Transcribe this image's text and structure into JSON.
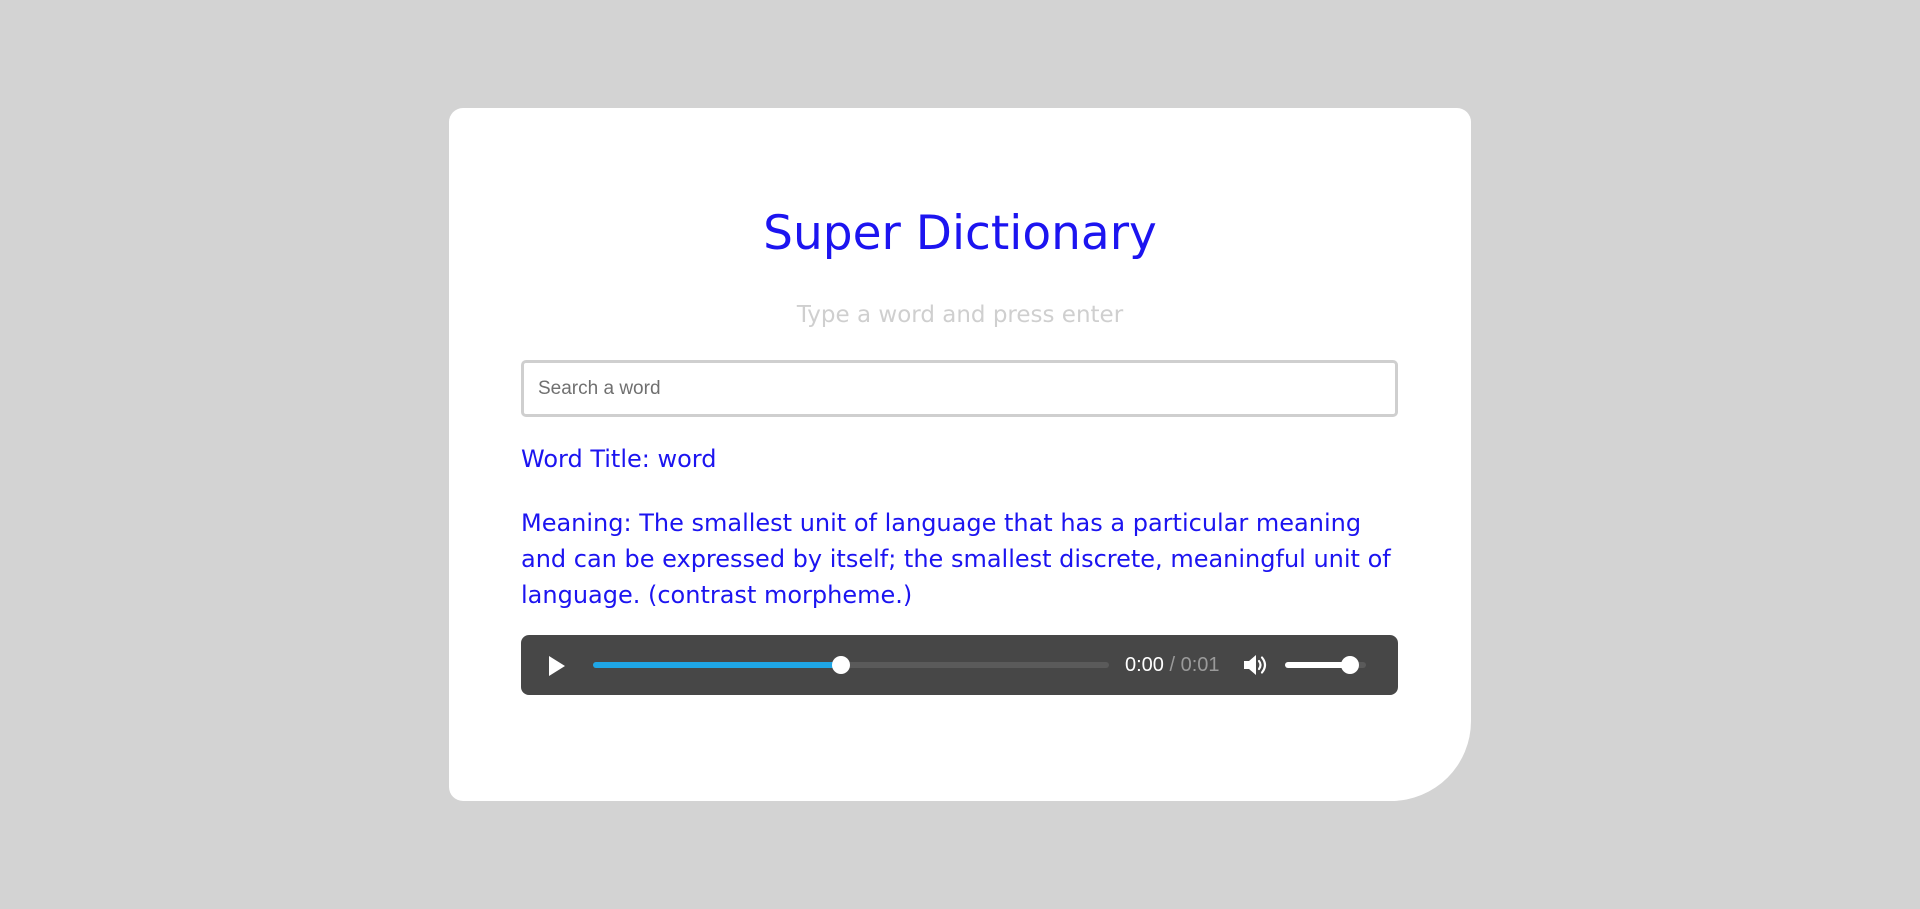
{
  "app": {
    "title": "Super Dictionary",
    "subtitle": "Type a word and press enter"
  },
  "search": {
    "placeholder": "Search a word",
    "value": ""
  },
  "result": {
    "word_title": "Word Title: word",
    "meaning": "Meaning: The smallest unit of language that has a particular meaning and can be expressed by itself; the smallest discrete, meaningful unit of language. (contrast morpheme.)"
  },
  "audio_player": {
    "current_time": "0:00",
    "separator": " / ",
    "duration": "0:01",
    "progress_fraction": 0.48,
    "volume_fraction": 0.8,
    "play_icon": "play-icon",
    "volume_icon": "volume-icon"
  },
  "colors": {
    "accent": "#1c14f0",
    "subtitle": "#cfcfcf",
    "background": "#d3d3d3",
    "player_bg": "#474747",
    "progress": "#1fa6e6"
  }
}
